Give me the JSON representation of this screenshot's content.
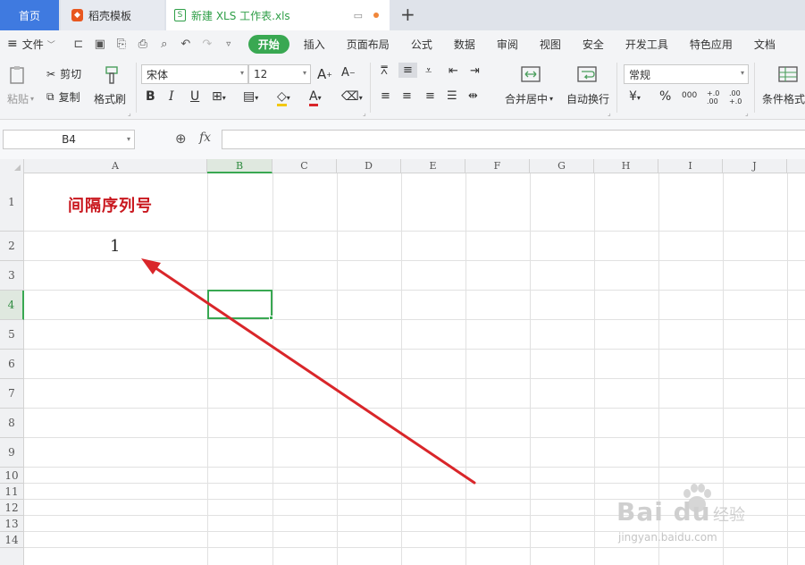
{
  "tabs": {
    "home": "首页",
    "docer": "稻壳模板",
    "document": "新建 XLS 工作表.xls",
    "new_tab": "+"
  },
  "menu": {
    "file": "文件",
    "tabs": [
      "开始",
      "插入",
      "页面布局",
      "公式",
      "数据",
      "审阅",
      "视图",
      "安全",
      "开发工具",
      "特色应用",
      "文档"
    ],
    "active_tab": "开始"
  },
  "ribbon": {
    "paste": "粘贴",
    "cut": "剪切",
    "copy": "复制",
    "format_painter": "格式刷",
    "font_name": "宋体",
    "font_size": "12",
    "bold": "B",
    "italic": "I",
    "underline": "U",
    "font_color_glyph": "A",
    "merge_center": "合并居中",
    "wrap_text": "自动换行",
    "number_format": "常规",
    "percent": "%",
    "thousands": "000",
    "inc_decimal": "+.0 .00",
    "dec_decimal": ".00 +.0",
    "conditional_format": "条件格式"
  },
  "formula_bar": {
    "name_box": "B4",
    "fx": "fx",
    "formula": ""
  },
  "grid": {
    "columns": [
      "A",
      "B",
      "C",
      "D",
      "E",
      "F",
      "G",
      "H",
      "I",
      "J"
    ],
    "rows": [
      "1",
      "2",
      "3",
      "4",
      "5",
      "6",
      "7",
      "8",
      "9",
      "10",
      "11",
      "12",
      "13",
      "14"
    ],
    "selected_column": "B",
    "selected_row": "4",
    "cells": {
      "A1": "间隔序列号",
      "A2": "1"
    }
  },
  "colors": {
    "accent_green": "#39a852",
    "title_red": "#c9171e",
    "arrow_red": "#d9262a",
    "home_tab_blue": "#3f7ae0"
  },
  "watermark": {
    "brand": "Bai du",
    "sub": "经验",
    "url": "jingyan.baidu.com"
  }
}
